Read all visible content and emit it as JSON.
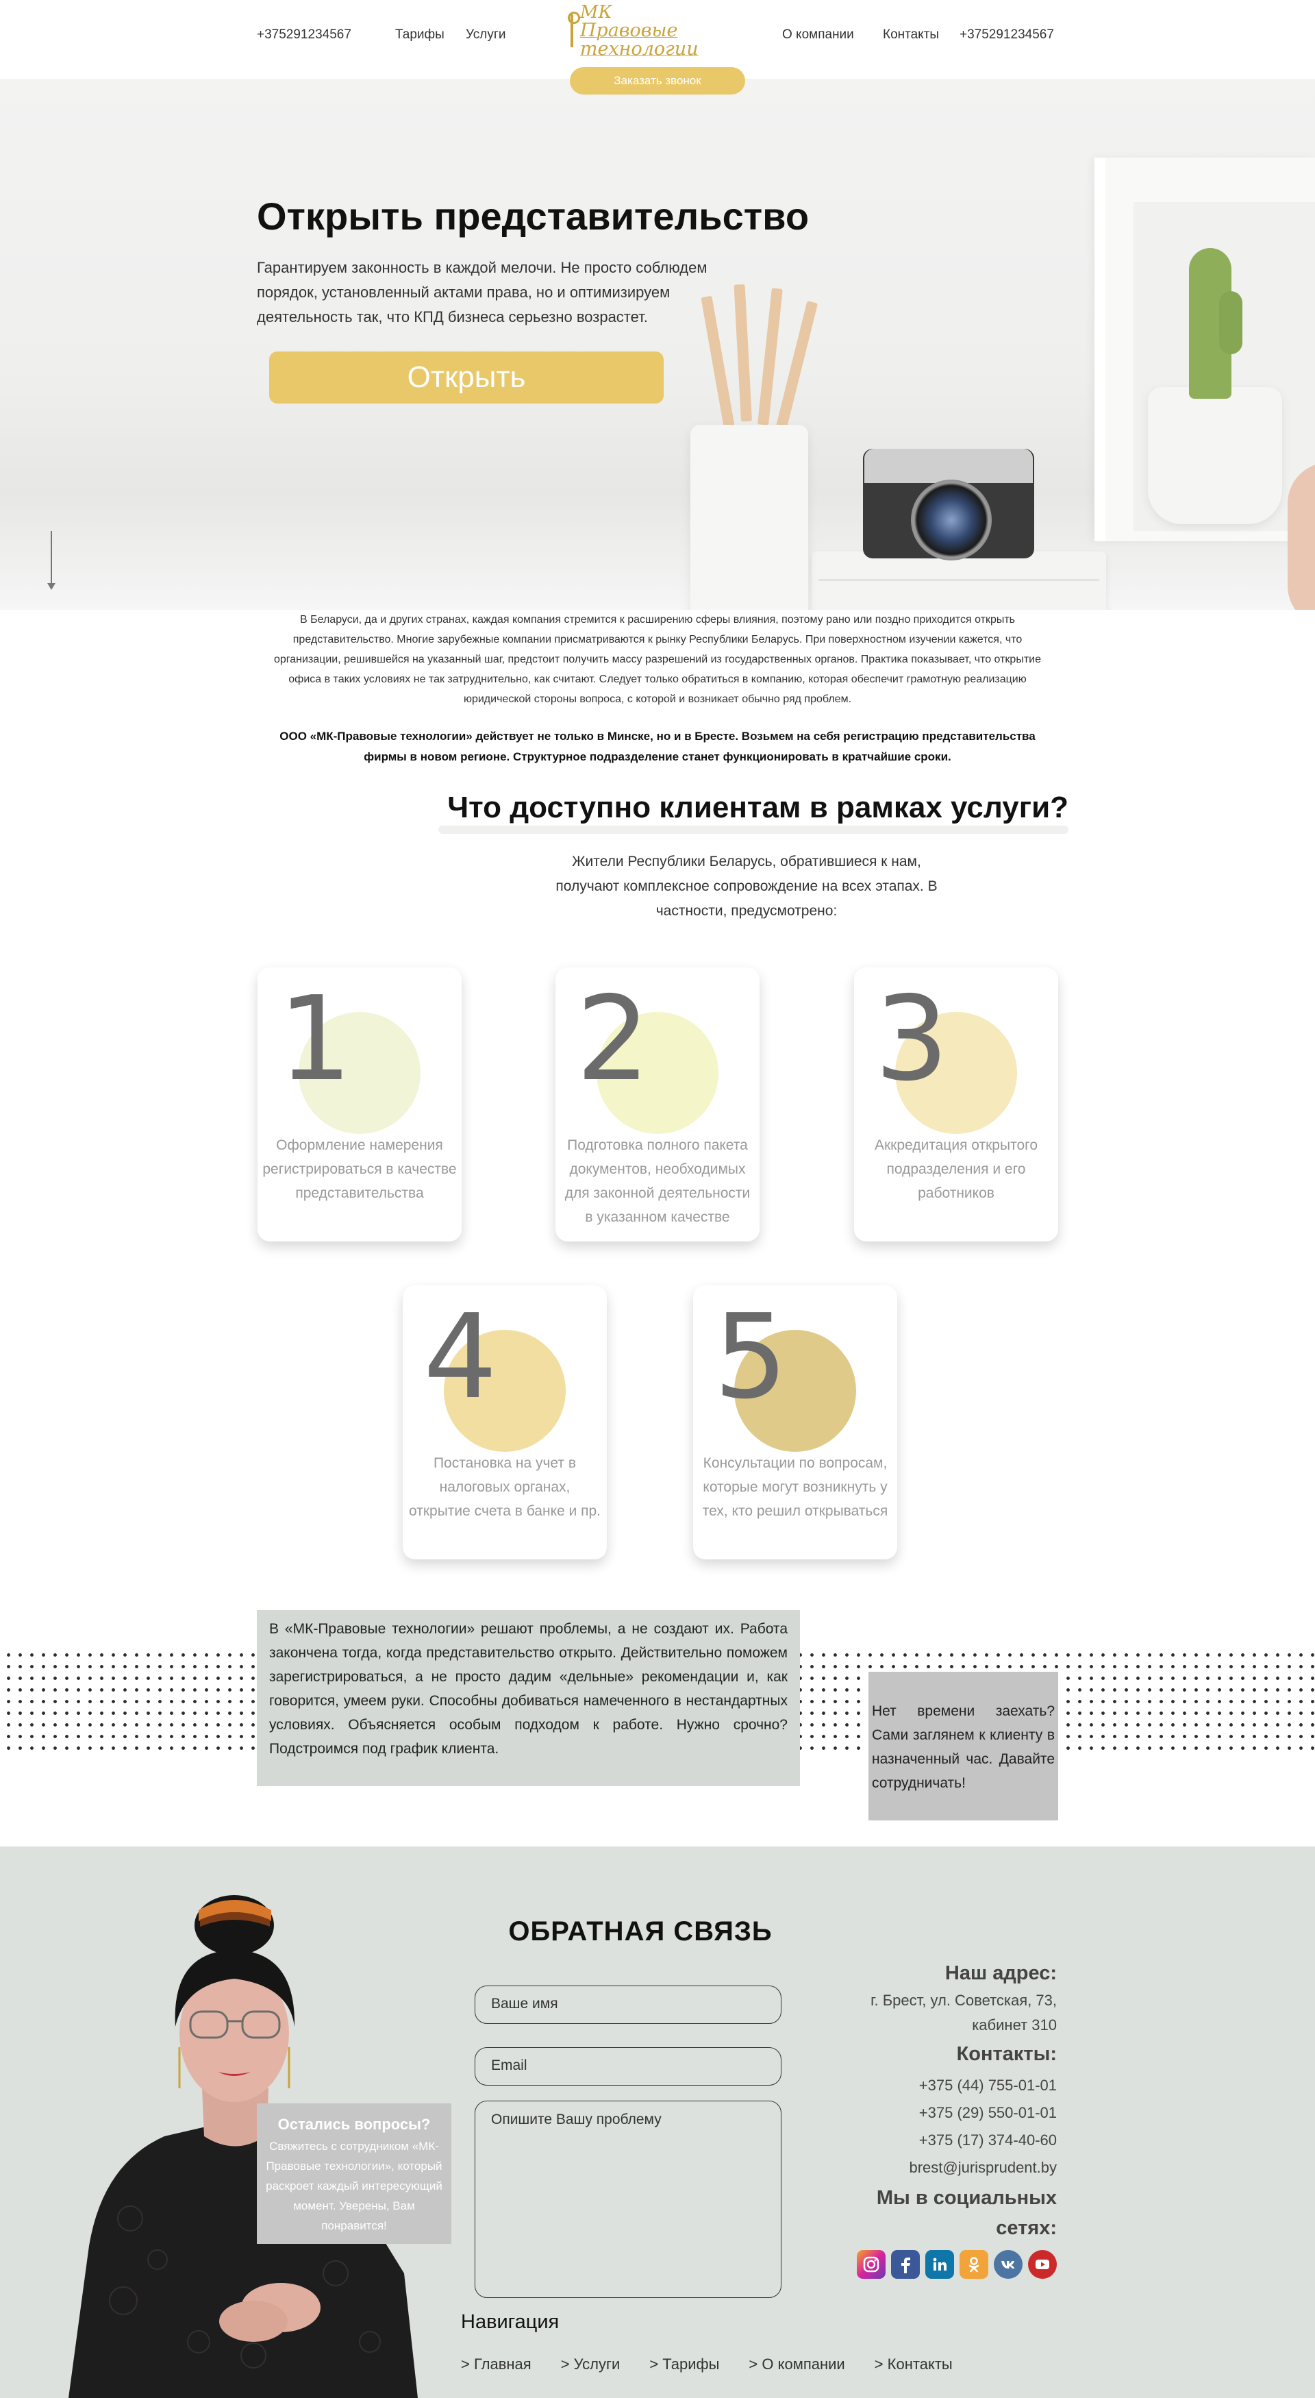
{
  "header": {
    "phone_left": "+375291234567",
    "nav_left": [
      "Тарифы",
      "Услуги"
    ],
    "logo_line1": "МК",
    "logo_line2": "Правовые технологии",
    "nav_right": [
      "О компании",
      "Контакты"
    ],
    "phone_right": "+375291234567",
    "callback_label": "Заказать звонок"
  },
  "hero": {
    "title": "Открыть представительство",
    "text": "Гарантируем законность в каждой мелочи. Не просто соблюдем порядок, установленный актами права, но и оптимизируем деятельность так, что КПД бизнеса серьезно возрастет.",
    "button": "Открыть"
  },
  "intro": {
    "paragraph": "В Беларуси, да и других странах, каждая компания стремится к расширению сферы влияния, поэтому рано или поздно приходится открыть представительство. Многие зарубежные компании присматриваются к рынку Республики Беларусь. При поверхностном изучении кажется, что организации, решившейся на указанный шаг, предстоит получить массу разрешений из государственных органов. Практика показывает, что открытие офиса в таких условиях не так затруднительно, как считают. Следует только обратиться в компанию, которая обеспечит грамотную реализацию юридической стороны вопроса, с которой и возникает обычно ряд проблем.",
    "bold": "ООО «МК-Правовые технологии» действует не только в Минске, но и в Бресте. Возьмем на себя регистрацию представительства фирмы в новом регионе. Структурное подразделение станет функционировать в кратчайшие сроки."
  },
  "services": {
    "title": "Что доступно клиентам в рамках услуги?",
    "subtitle": "Жители Республики Беларусь, обратившиеся к нам, получают комплексное сопровождение на всех этапах. В частности, предусмотрено:",
    "cards": [
      {
        "num": "1",
        "text": "Оформление намерения регистрироваться в качестве представительства",
        "color": "#f2f4d8"
      },
      {
        "num": "2",
        "text": "Подготовка полного пакета документов, необходимых для законной деятельности в указанном качестве",
        "color": "#f4f6c9"
      },
      {
        "num": "3",
        "text": "Аккредитация открытого подразделения и его работников",
        "color": "#f6e9bb"
      },
      {
        "num": "4",
        "text": "Постановка на учет в налоговых органах, открытие счета в банке и пр.",
        "color": "#f2dea0"
      },
      {
        "num": "5",
        "text": "Консультации по вопросам, которые могут возникнуть у тех, кто решил открываться",
        "color": "#dfca89"
      }
    ]
  },
  "promo": {
    "left": "В «МК-Правовые технологии» решают проблемы, а не создают их. Работа закончена тогда, когда представительство открыто. Действительно поможем зарегистрироваться, а не просто дадим «дельные» рекомендации и, как говорится, умеем руки. Способны добиваться намеченного в нестандартных условиях. Объясняется особым подходом к работе. Нужно срочно? Подстроимся под график клиента.",
    "right": "Нет времени заехать? Сами заглянем к клиенту в назначенный час. Давайте сотрудничать!"
  },
  "feedback": {
    "title": "ОБРАТНАЯ СВЯЗЬ",
    "name_placeholder": "Ваше имя",
    "email_placeholder": "Email",
    "problem_placeholder": "Опишите Вашу проблему",
    "questions_title": "Остались вопросы?",
    "questions_text": "Свяжитесь с сотрудником «МК-Правовые технологии», который раскроет каждый интересующий момент. Уверены, Вам понравится!"
  },
  "contacts": {
    "address_head": "Наш адрес:",
    "address_line1": "г. Брест, ул. Советская, 73,",
    "address_line2": "кабинет 310",
    "contacts_head": "Контакты:",
    "phone1": "+375 (44) 755-01-01",
    "phone2": "+375 (29) 550-01-01",
    "phone3": "+375 (17) 374-40-60",
    "email": "brest@jurisprudent.by",
    "social_head_line1": "Мы в социальных",
    "social_head_line2": "сетях:",
    "social_icons": [
      "instagram-icon",
      "facebook-icon",
      "linkedin-icon",
      "odnoklassniki-icon",
      "vk-icon",
      "youtube-icon"
    ]
  },
  "navigation": {
    "title": "Навигация",
    "items": [
      "> Главная",
      "> Услуги",
      "> Тарифы",
      "> О компании",
      "> Контакты"
    ]
  },
  "colors": {
    "accent": "#e9c869",
    "footer_bg": "#dce1dd",
    "promo_left_bg": "#d4d9d5",
    "promo_right_bg": "#c4c4c4"
  }
}
